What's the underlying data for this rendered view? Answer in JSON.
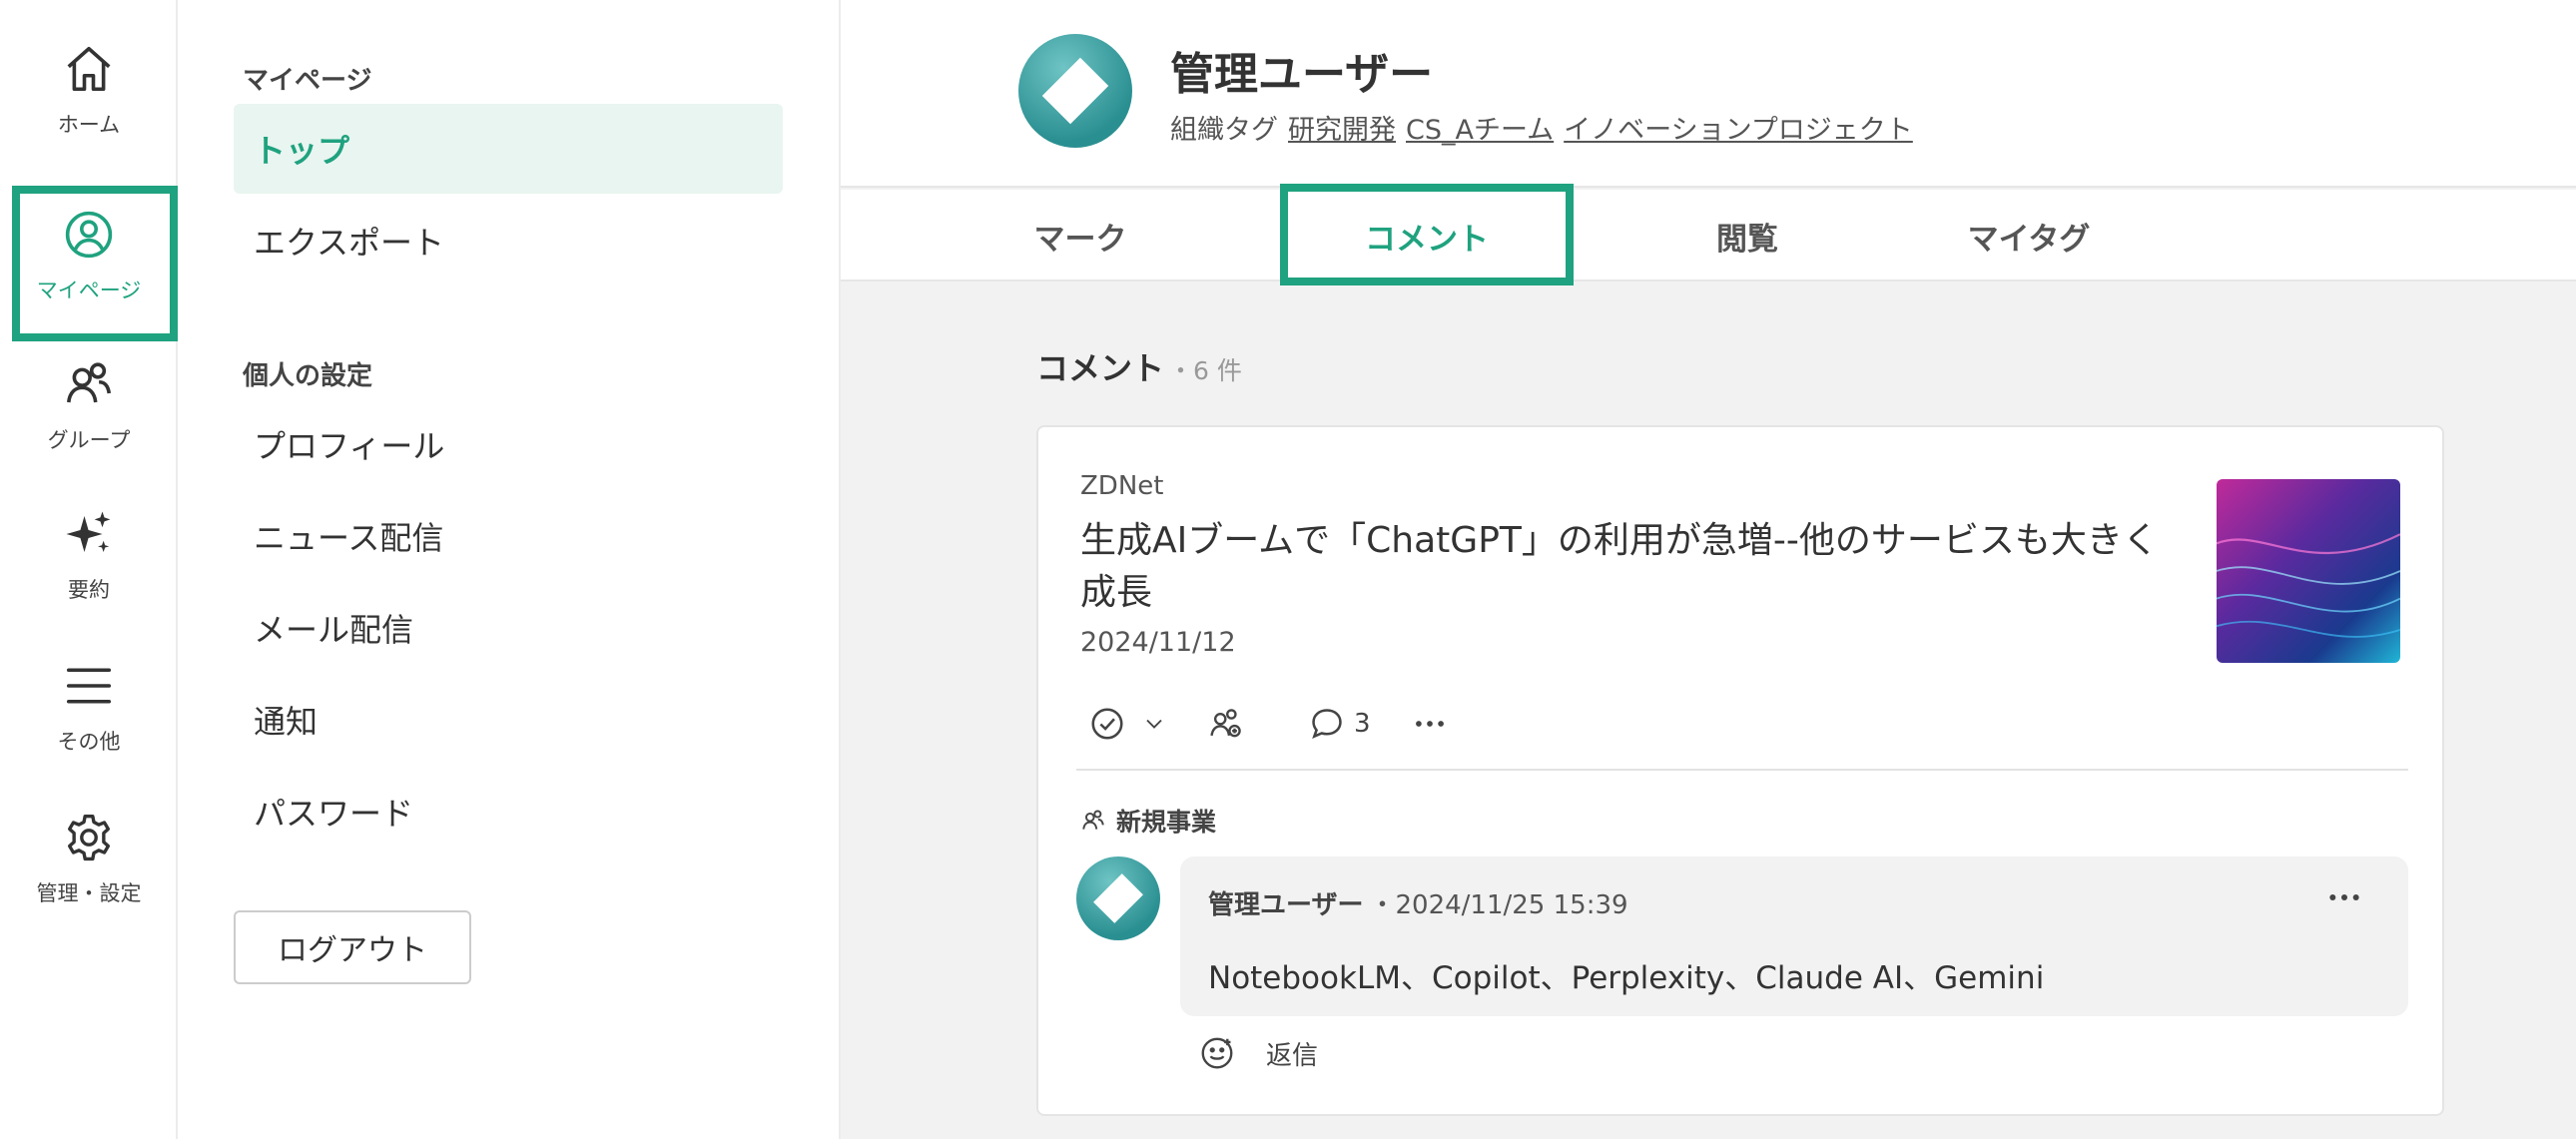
{
  "rail": {
    "items": [
      {
        "label": "ホーム",
        "icon": "home-icon"
      },
      {
        "label": "マイページ",
        "icon": "user-circle-icon",
        "active": true
      },
      {
        "label": "グループ",
        "icon": "group-icon"
      },
      {
        "label": "要約",
        "icon": "sparkles-icon"
      },
      {
        "label": "その他",
        "icon": "menu-icon"
      },
      {
        "label": "管理・設定",
        "icon": "gear-icon"
      }
    ]
  },
  "sidebar": {
    "section1_title": "マイページ",
    "section1_items": [
      {
        "label": "トップ",
        "active": true
      },
      {
        "label": "エクスポート"
      }
    ],
    "section2_title": "個人の設定",
    "section2_items": [
      {
        "label": "プロフィール"
      },
      {
        "label": "ニュース配信"
      },
      {
        "label": "メール配信"
      },
      {
        "label": "通知"
      },
      {
        "label": "パスワード"
      }
    ],
    "logout_label": "ログアウト"
  },
  "header": {
    "user_name": "管理ユーザー",
    "tags_label": "組織タグ",
    "tags": [
      "研究開発",
      "CS_Aチーム",
      "イノベーションプロジェクト"
    ]
  },
  "tabs": [
    {
      "label": "マーク"
    },
    {
      "label": "コメント",
      "active": true
    },
    {
      "label": "閲覧"
    },
    {
      "label": "マイタグ"
    }
  ],
  "section": {
    "title": "コメント",
    "count": "・6 件"
  },
  "card": {
    "source": "ZDNet",
    "title": "生成AIブームで「ChatGPT」の利用が急増--他のサービスも大きく成長",
    "date": "2024/11/12",
    "comment_count": "3",
    "group": "新規事業",
    "comment": {
      "author": "管理ユーザー",
      "time": "・2024/11/25 15:39",
      "text": "NotebookLM、Copilot、Perplexity、Claude AI、Gemini"
    },
    "reply_label": "返信"
  },
  "colors": {
    "accent": "#1fa27f",
    "active_bg": "#e9f5f0",
    "main_bg": "#f2f2f2"
  }
}
